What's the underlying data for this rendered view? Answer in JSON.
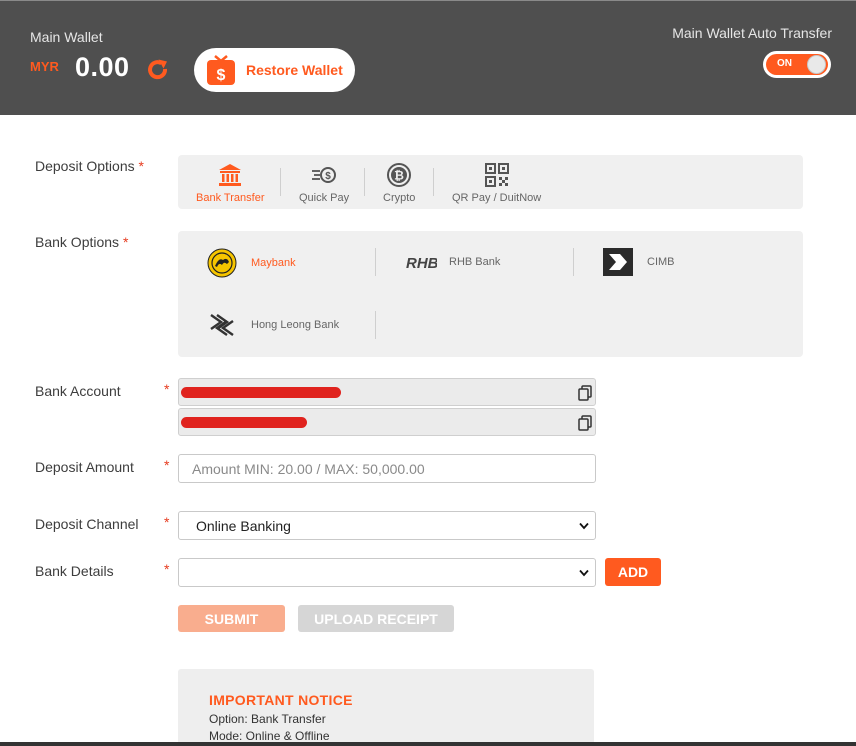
{
  "header": {
    "wallet_label": "Main Wallet",
    "currency": "MYR",
    "balance": "0.00",
    "restore_label": "Restore Wallet",
    "auto_transfer_label": "Main Wallet Auto Transfer",
    "toggle_state": "ON"
  },
  "form": {
    "required_mark": "*",
    "deposit_options_label": "Deposit Options",
    "bank_options_label": "Bank Options",
    "bank_account_label": "Bank Account",
    "deposit_amount_label": "Deposit Amount",
    "deposit_channel_label": "Deposit Channel",
    "bank_details_label": "Bank Details"
  },
  "deposit_options": [
    {
      "label": "Bank Transfer",
      "icon": "bank-icon",
      "active": true
    },
    {
      "label": "Quick Pay",
      "icon": "quick-pay-icon",
      "active": false
    },
    {
      "label": "Crypto",
      "icon": "bitcoin-icon",
      "active": false
    },
    {
      "label": "QR Pay / DuitNow",
      "icon": "qr-code-icon",
      "active": false
    }
  ],
  "banks": [
    {
      "label": "Maybank",
      "icon": "maybank-logo",
      "active": true
    },
    {
      "label": "RHB Bank",
      "icon": "rhb-logo",
      "active": false
    },
    {
      "label": "CIMB",
      "icon": "cimb-logo",
      "active": false
    },
    {
      "label": "Hong Leong Bank",
      "icon": "hong-leong-logo",
      "active": false
    }
  ],
  "rhb_logo_text": "RHB",
  "amount": {
    "placeholder": "Amount MIN: 20.00 / MAX: 50,000.00",
    "value": ""
  },
  "channel": {
    "selected": "Online Banking"
  },
  "bank_details": {
    "selected": ""
  },
  "buttons": {
    "add": "ADD",
    "submit": "SUBMIT",
    "upload": "UPLOAD RECEIPT"
  },
  "notice": {
    "title": "IMPORTANT NOTICE",
    "line1": "Option: Bank Transfer",
    "line2": "Mode: Online & Offline"
  },
  "colors": {
    "accent": "#ff5a1f",
    "header_bg": "#4f4f4f",
    "panel_bg": "#f0f0f0"
  }
}
